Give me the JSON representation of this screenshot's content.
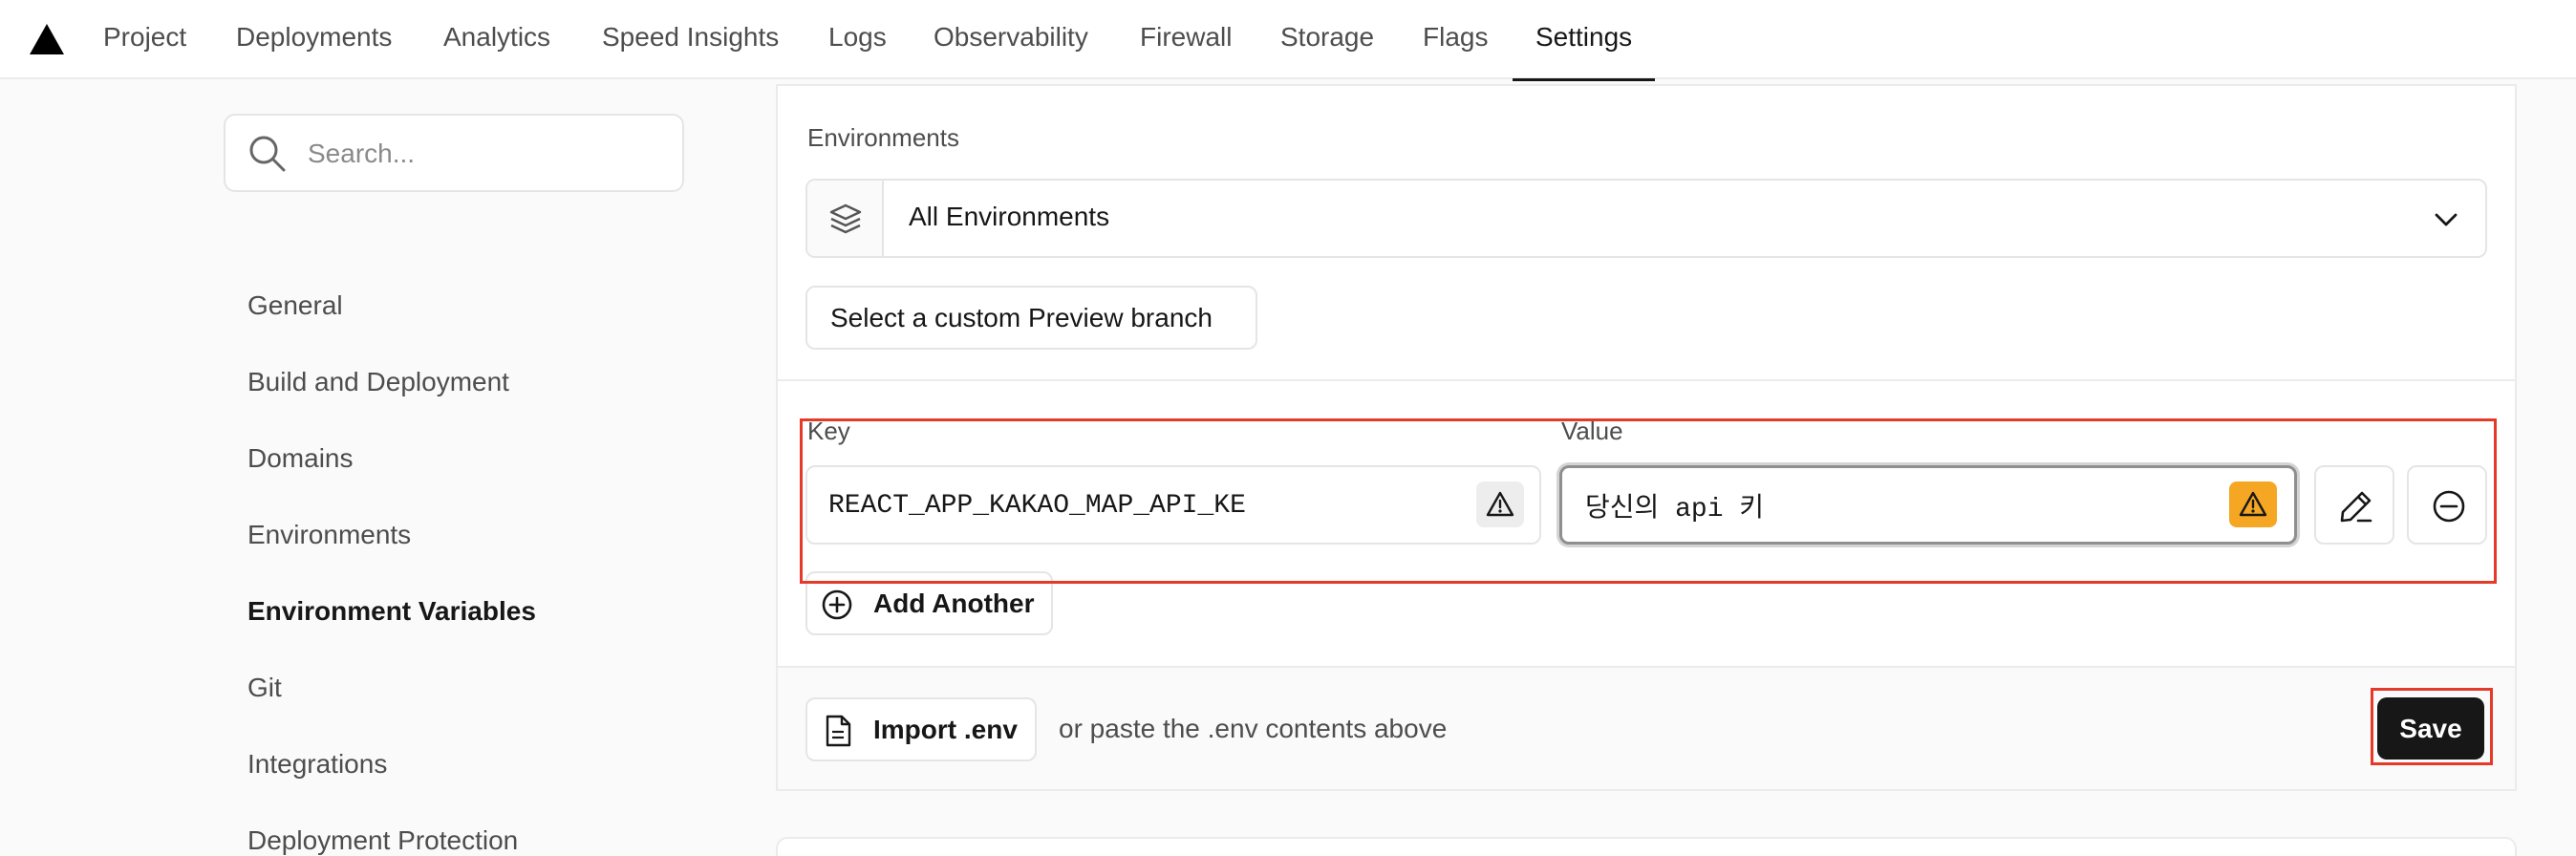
{
  "nav": {
    "tabs": [
      {
        "label": "Project"
      },
      {
        "label": "Deployments"
      },
      {
        "label": "Analytics"
      },
      {
        "label": "Speed Insights"
      },
      {
        "label": "Logs"
      },
      {
        "label": "Observability"
      },
      {
        "label": "Firewall"
      },
      {
        "label": "Storage"
      },
      {
        "label": "Flags"
      },
      {
        "label": "Settings",
        "active": true
      }
    ]
  },
  "sidebar": {
    "search_placeholder": "Search...",
    "items": [
      {
        "label": "General"
      },
      {
        "label": "Build and Deployment"
      },
      {
        "label": "Domains"
      },
      {
        "label": "Environments"
      },
      {
        "label": "Environment Variables",
        "active": true
      },
      {
        "label": "Git"
      },
      {
        "label": "Integrations"
      },
      {
        "label": "Deployment Protection"
      }
    ]
  },
  "form": {
    "environments_label": "Environments",
    "environments_value": "All Environments",
    "preview_branch_button": "Select a custom Preview branch",
    "key_label": "Key",
    "key_value": "REACT_APP_KAKAO_MAP_API_KE",
    "value_label": "Value",
    "value_value": "당신의 api 키 ",
    "add_another_label": "Add Another",
    "import_label": "Import .env",
    "paste_hint": "or paste the .env contents above",
    "save_label": "Save"
  },
  "colors": {
    "accent": "#171717",
    "warning": "#f5a623",
    "highlight": "#e53a2a"
  },
  "icons": {
    "logo": "triangle-logo-icon",
    "search": "search-icon",
    "layers": "layers-icon",
    "chevron": "chevron-down-icon",
    "warning": "warning-triangle-icon",
    "edit": "pencil-icon",
    "remove": "minus-circle-icon",
    "add": "plus-circle-icon",
    "file": "file-icon"
  }
}
